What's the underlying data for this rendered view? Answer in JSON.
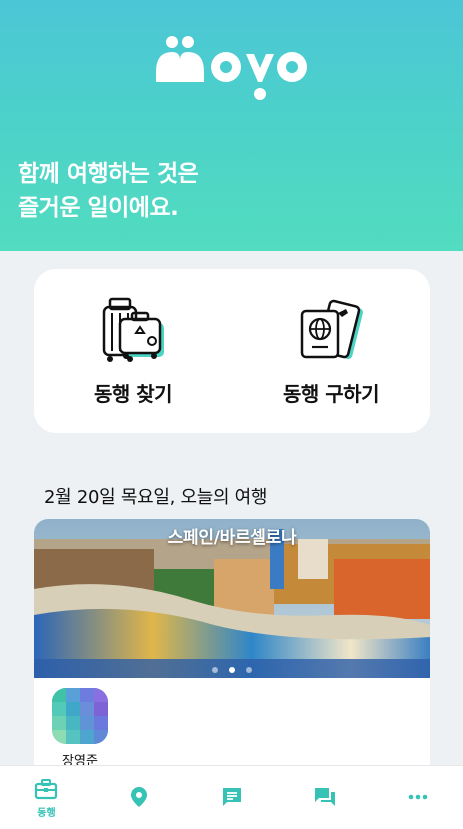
{
  "app": {
    "logo_text": "moyo",
    "brand_color": "#36c2b4"
  },
  "hero": {
    "tagline_line1": "함께 여행하는 것은",
    "tagline_line2": "즐거운 일이에요."
  },
  "menu": {
    "find_label": "동행 찾기",
    "find_icon": "luggage-icon",
    "seek_label": "동행 구하기",
    "seek_icon": "passport-ticket-icon"
  },
  "today": {
    "title": "2월 20일 목요일, 오늘의 여행",
    "trip": {
      "place": "스페인/바르셀로나",
      "image": "park-guell-photo",
      "slides": 3,
      "active_slide": 2,
      "user_name": "장영준"
    }
  },
  "bottom_nav": {
    "items": [
      {
        "label": "동행",
        "icon": "briefcase-icon",
        "active": true
      },
      {
        "label": "",
        "icon": "location-pin-icon",
        "active": false
      },
      {
        "label": "",
        "icon": "chat-bubble-icon",
        "active": false
      },
      {
        "label": "",
        "icon": "chat-bubbles-icon",
        "active": false
      },
      {
        "label": "",
        "icon": "more-dots-icon",
        "active": false
      }
    ]
  }
}
